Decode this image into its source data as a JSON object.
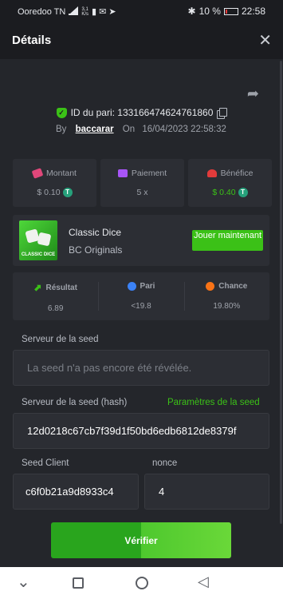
{
  "status": {
    "carrier": "Ooredoo TN",
    "speed_top": "3,1",
    "speed_bottom": "K/s",
    "battery": "10 %",
    "time": "22:58"
  },
  "header": {
    "title": "Détails",
    "close": "✕"
  },
  "bet": {
    "id_label": "ID du pari: 133166474624761860",
    "by_label": "By",
    "user": "baccarar",
    "on_label": "On",
    "date": "16/04/2023 22:58:32"
  },
  "stats": {
    "amount": {
      "label": "Montant",
      "value": "$ 0.10",
      "icon": "wallet-icon",
      "color": "#e0477a"
    },
    "payout": {
      "label": "Paiement",
      "value": "5 x",
      "icon": "card-icon",
      "color": "#a855f7"
    },
    "profit": {
      "label": "Bénéfice",
      "value": "$ 0.40",
      "icon": "coins-icon",
      "color": "#e23b3b"
    }
  },
  "coin_symbol": "T",
  "game": {
    "name": "Classic Dice",
    "provider": "BC Originals",
    "thumb_caption": "CLASSIC DICE",
    "play_label": "Jouer maintenant"
  },
  "results": {
    "result": {
      "label": "Résultat",
      "value": "6.89",
      "icon": "chart-icon",
      "color": "#3bc117"
    },
    "bet": {
      "label": "Pari",
      "value": "<19.8",
      "icon": "target-icon",
      "color": "#3b82f6"
    },
    "chance": {
      "label": "Chance",
      "value": "19.80%",
      "icon": "percent-icon",
      "color": "#f97316"
    }
  },
  "seed": {
    "server_label": "Serveur de la seed",
    "server_placeholder": "La seed n'a pas encore été révélée.",
    "hash_label": "Serveur de la seed (hash)",
    "settings_link": "Paramètres de la seed",
    "hash_value": "12d0218c67cb7f39d1f50bd6edb6812de8379f",
    "client_label": "Seed Client",
    "client_value": "c6f0b21a9d8933c4",
    "nonce_label": "nonce",
    "nonce_value": "4"
  },
  "verify_label": "Vérifier",
  "nav": {
    "back": "◁",
    "home": "○",
    "recents": "□",
    "down": "⌄"
  }
}
